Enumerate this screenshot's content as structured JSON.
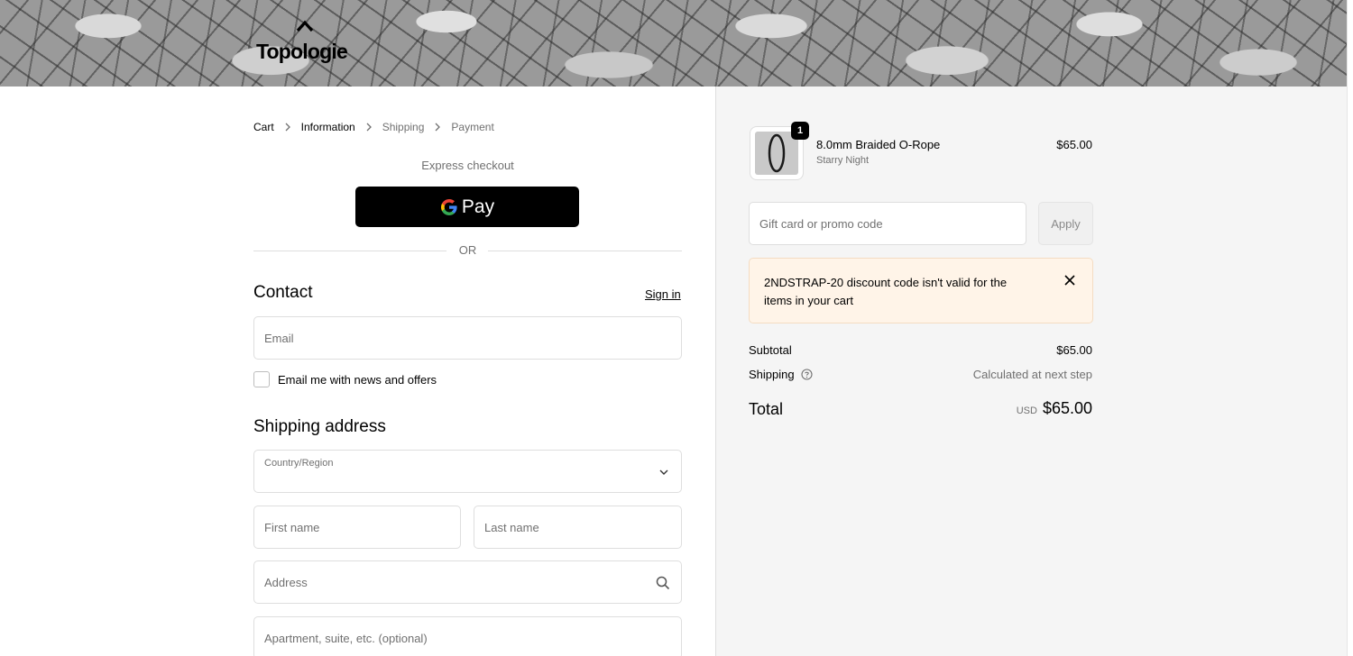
{
  "brand": {
    "name": "Topologie",
    "logo_icon": "chevron-up-icon"
  },
  "breadcrumb": {
    "items": [
      {
        "label": "Cart",
        "state": "link"
      },
      {
        "label": "Information",
        "state": "active"
      },
      {
        "label": "Shipping",
        "state": "inactive"
      },
      {
        "label": "Payment",
        "state": "inactive"
      }
    ],
    "separator_icon": "chevron-right-icon"
  },
  "express": {
    "heading": "Express checkout",
    "gpay_label": "Pay",
    "divider": "OR"
  },
  "contact": {
    "heading": "Contact",
    "sign_in": "Sign in",
    "email_placeholder": "Email",
    "newsletter_label": "Email me with news and offers",
    "newsletter_checked": false
  },
  "shipping_address": {
    "heading": "Shipping address",
    "country_label": "Country/Region",
    "country_value": "",
    "first_name_placeholder": "First name",
    "last_name_placeholder": "Last name",
    "address_placeholder": "Address",
    "apartment_placeholder": "Apartment, suite, etc. (optional)"
  },
  "order": {
    "item": {
      "quantity": "1",
      "name": "8.0mm Braided O-Rope",
      "variant": "Starry Night",
      "price": "$65.00"
    },
    "promo_placeholder": "Gift card or promo code",
    "apply_label": "Apply",
    "alert": "2NDSTRAP-20 discount code isn't valid for the items in your cart",
    "subtotal_label": "Subtotal",
    "subtotal_value": "$65.00",
    "shipping_label": "Shipping",
    "shipping_value": "Calculated at next step",
    "total_label": "Total",
    "total_currency": "USD",
    "total_value": "$65.00"
  },
  "colors": {
    "alert_bg": "#fff4e8",
    "summary_bg": "#f5f5f5",
    "button_black": "#000000"
  }
}
